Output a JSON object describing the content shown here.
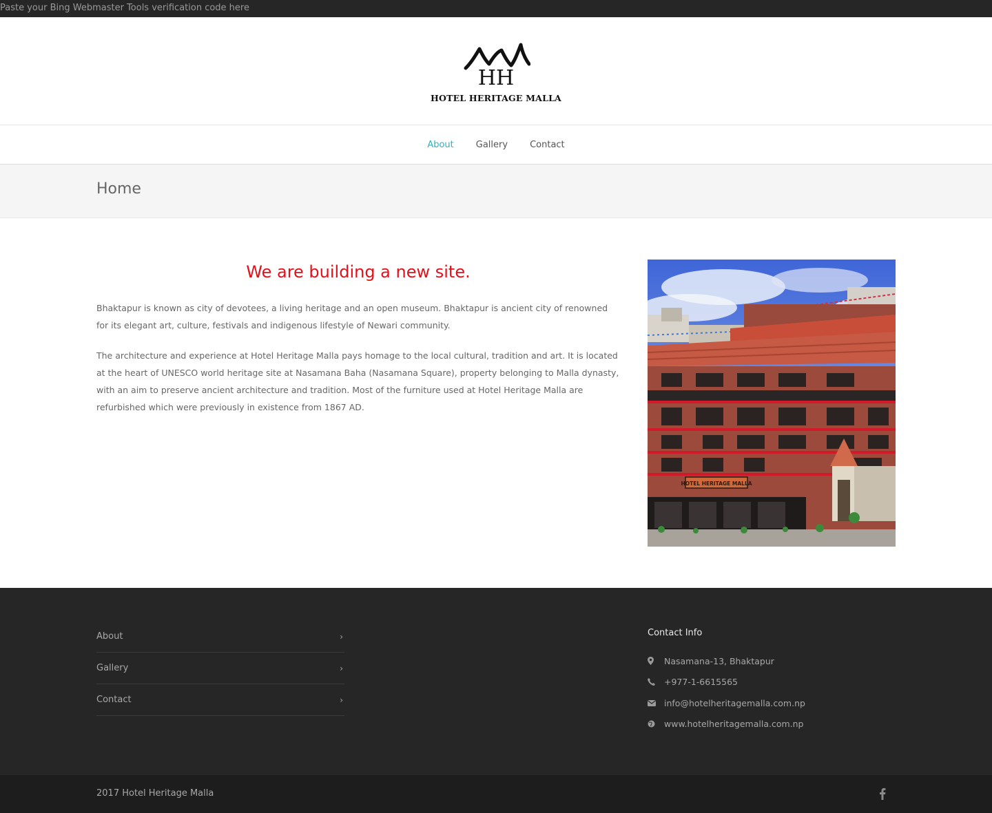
{
  "topbar": {
    "text": "Paste your Bing Webmaster Tools verification code here"
  },
  "brand": {
    "name": "HOTEL HERITAGE MALLA",
    "monogram": "HH"
  },
  "nav": {
    "items": [
      {
        "label": "About",
        "active": true
      },
      {
        "label": "Gallery",
        "active": false
      },
      {
        "label": "Contact",
        "active": false
      }
    ]
  },
  "page": {
    "title": "Home"
  },
  "main": {
    "heading": "We are building a new site.",
    "paragraphs": [
      "Bhaktapur is known as city of devotees, a living heritage and an open museum. Bhaktapur is ancient city of renowned for its elegant art, culture, festivals and indigenous lifestyle of Newari community.",
      "The architecture and experience at Hotel Heritage Malla pays homage to the local cultural, tradition and art. It is located at the heart of UNESCO world heritage site at Nasamana Baha (Nasamana Square), property belonging to Malla dynasty, with an aim to preserve ancient architecture and tradition.  Most of the furniture used at Hotel Heritage Malla are refurbished which were previously in existence from 1867 AD."
    ],
    "photo_sign": "HOTEL HERITAGE MALLA"
  },
  "footer": {
    "links": [
      {
        "label": "About"
      },
      {
        "label": "Gallery"
      },
      {
        "label": "Contact"
      }
    ],
    "contact": {
      "title": "Contact Info",
      "address": "Nasamana-13, Bhaktapur",
      "phone": "+977-1-6615565",
      "email": "info@hotelheritagemalla.com.np",
      "website": "www.hotelheritagemalla.com.np"
    },
    "copyright": "2017 Hotel Heritage Malla",
    "social": "facebook-icon"
  },
  "colors": {
    "accent": "#2ab3c0",
    "heading_red": "#e3101a",
    "footer_bg": "#262626",
    "bottom_bg": "#1d1d1d"
  }
}
